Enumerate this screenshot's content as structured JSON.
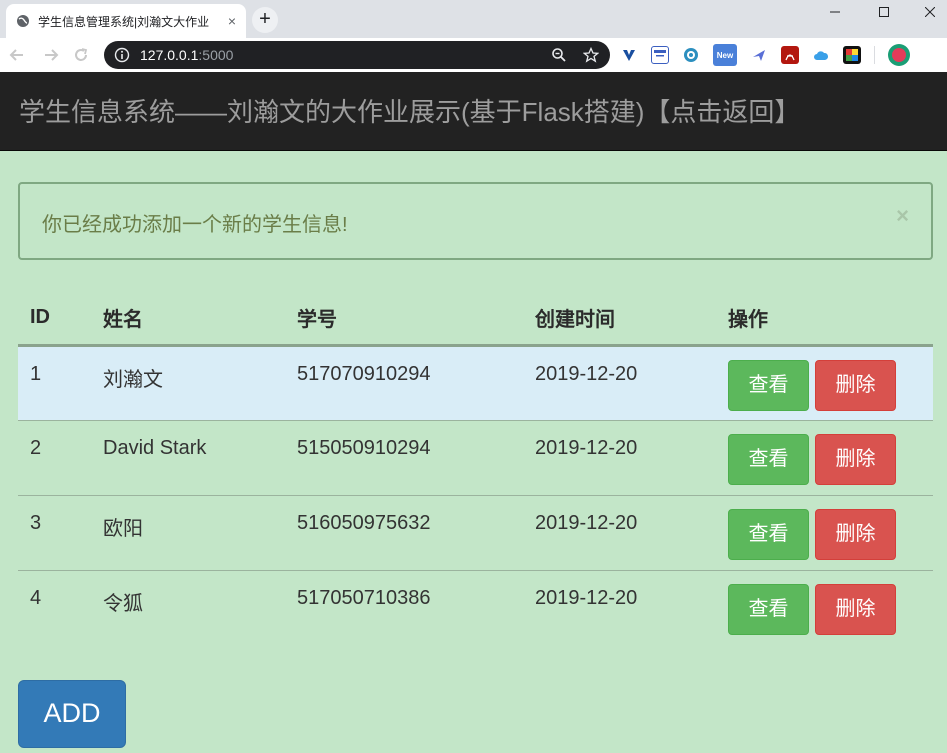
{
  "browser": {
    "tab_title": "学生信息管理系统|刘瀚文大作业",
    "tab_close": "×",
    "new_tab": "+",
    "url_host": "127.0.0.1",
    "url_port": ":5000",
    "ext_new_badge": "New"
  },
  "navbar": {
    "brand": "学生信息系统——刘瀚文的大作业展示(基于Flask搭建)【点击返回】"
  },
  "alert": {
    "message": "你已经成功添加一个新的学生信息!",
    "close": "×"
  },
  "table": {
    "headers": [
      "ID",
      "姓名",
      "学号",
      "创建时间",
      "操作"
    ],
    "rows": [
      {
        "id": "1",
        "name": "刘瀚文",
        "sno": "517070910294",
        "date": "2019-12-20"
      },
      {
        "id": "2",
        "name": "David Stark",
        "sno": "515050910294",
        "date": "2019-12-20"
      },
      {
        "id": "3",
        "name": "欧阳",
        "sno": "516050975632",
        "date": "2019-12-20"
      },
      {
        "id": "4",
        "name": "令狐",
        "sno": "517050710386",
        "date": "2019-12-20"
      }
    ],
    "view_label": "查看",
    "delete_label": "删除"
  },
  "add_button": "ADD",
  "colors": {
    "page_background": "#c3e6c8",
    "navbar": "#222222",
    "highlight_row": "#d9edf7",
    "success": "#5cb85c",
    "danger": "#d9534f",
    "primary": "#337ab7"
  }
}
